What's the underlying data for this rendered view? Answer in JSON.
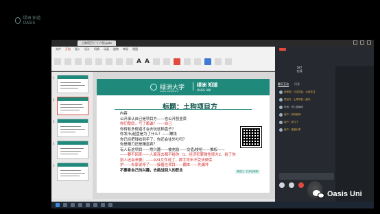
{
  "window": {
    "doc_tab": "土狗项目 (一) 介绍.pptx"
  },
  "ribbon": {
    "menus": [
      "文件",
      "开始",
      "插入",
      "设计",
      "切换",
      "动画",
      "放映",
      "审阅",
      "视图"
    ],
    "active_menu": "开始",
    "glyph_a": "A",
    "glyph_a2": "A"
  },
  "slide": {
    "logo_zh": "绿洲大学",
    "logo_sub": "OASIS UNIVERSITY",
    "logo2_zh": "绿洲 知道",
    "logo2_en": "OASIS UNI",
    "title": "标题：土狗项目方",
    "body": {
      "l0": "内容",
      "l1": "公开承认自己是项目方——也公开割韭菜",
      "l2": "你们赞同，亏了赖谁？——自己",
      "l3": "你得有多傻逼才会去玩这种盘子？",
      "l4": "你发币/起盘是为了什么？——赚钱",
      "l5": "你已经把钱收到手了，你还会往外吐吗？",
      "l6": "你是赚刀还是赚嘉宾？",
      "l7": "有人有这项目——然兴趣——被充励——交值/梭哈——推权——",
      "l8": "——要不回来——人家连去都不给你（1、经济犯罪弹性很大2、给了你别人还会来要）——924文件说了，数字货币不受法律保",
      "l9": "护——去家说停了——接着拉项目——翻本——先骗坏",
      "l10": "不要拿自己的兴趣，去挑战别人的职业"
    },
    "qr_label": "微信扫一扫添加客服"
  },
  "live": {
    "stat1_value": "587",
    "stat1_label": "在线",
    "stat2_value": "5000",
    "stat2_label": "点赞",
    "tab1": "聊天互动",
    "tab2": "问答",
    "chats": [
      "老师说：讨论项目，大家关注",
      "项目方：土狗项目一起来",
      "系统：进入直播间",
      "用户：好的老师",
      "用户：学习了",
      "用户：感谢分享"
    ]
  },
  "brand": {
    "name": "Oasis Uni"
  },
  "stream_logo": "绿洲 知道 OASIS"
}
